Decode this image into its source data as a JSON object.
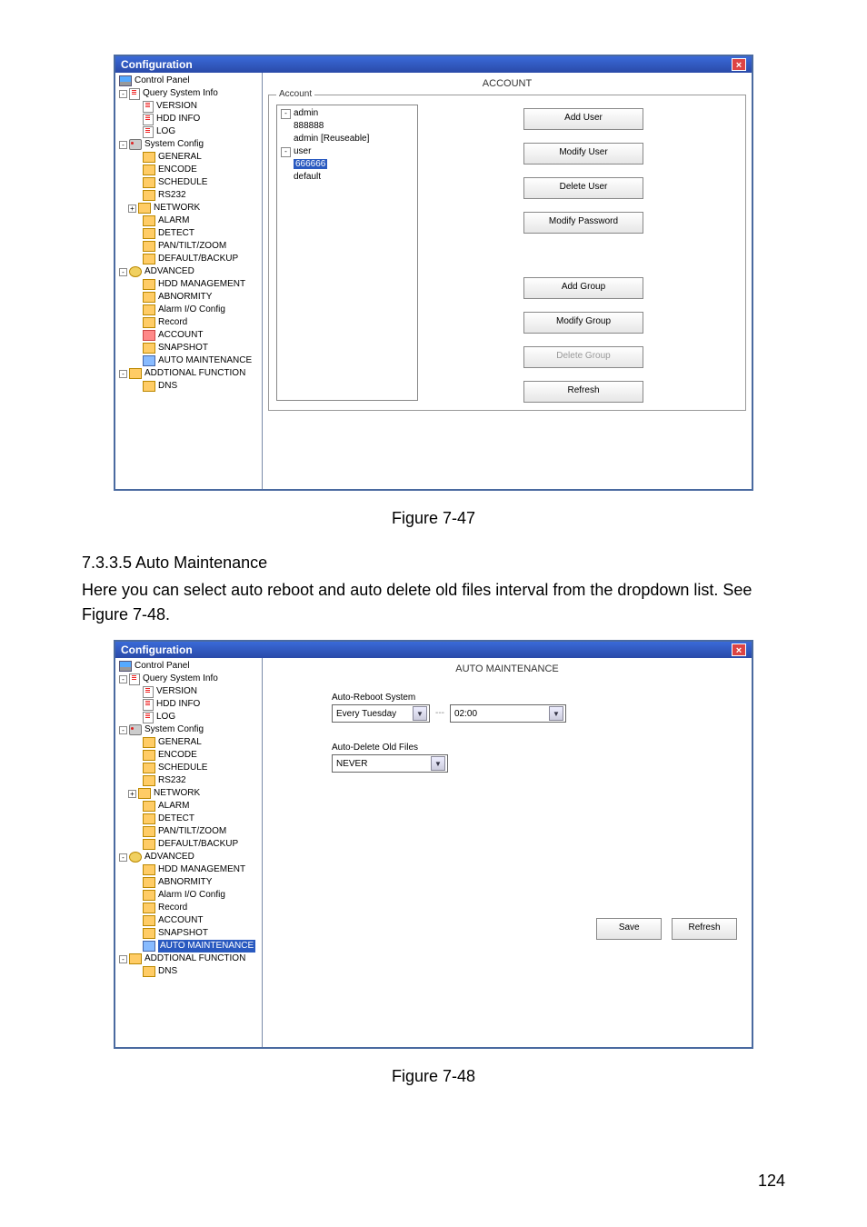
{
  "page_number": "124",
  "figure1_caption": "Figure 7-47",
  "figure2_caption": "Figure 7-48",
  "section_heading": "7.3.3.5  Auto Maintenance",
  "section_body": "Here you can select auto reboot and auto delete old files interval from the dropdown list.  See Figure 7-48.",
  "win": {
    "title": "Configuration",
    "close": "×"
  },
  "tree": {
    "control_panel": "Control Panel",
    "query_system_info": "Query System Info",
    "version": "VERSION",
    "hdd_info": "HDD INFO",
    "log": "LOG",
    "system_config": "System Config",
    "general": "GENERAL",
    "encode": "ENCODE",
    "schedule": "SCHEDULE",
    "rs232": "RS232",
    "network": "NETWORK",
    "alarm": "ALARM",
    "detect": "DETECT",
    "pan_tilt_zoom": "PAN/TILT/ZOOM",
    "default_backup": "DEFAULT/BACKUP",
    "advanced": "ADVANCED",
    "hdd_management": "HDD MANAGEMENT",
    "abnormity": "ABNORMITY",
    "alarm_io_config": "Alarm I/O Config",
    "record": "Record",
    "account": "ACCOUNT",
    "snapshot": "SNAPSHOT",
    "auto_maintenance": "AUTO MAINTENANCE",
    "additional_function": "ADDTIONAL FUNCTION",
    "dns": "DNS"
  },
  "account_panel": {
    "header": "ACCOUNT",
    "legend": "Account",
    "tree": {
      "admin": "admin",
      "n888888": "888888",
      "admin_reuse": "admin [Reuseable]",
      "user": "user",
      "n666666": "666666",
      "default": "default"
    },
    "buttons": {
      "add_user": "Add User",
      "modify_user": "Modify User",
      "delete_user": "Delete User",
      "modify_password": "Modify Password",
      "add_group": "Add Group",
      "modify_group": "Modify Group",
      "delete_group": "Delete Group",
      "refresh": "Refresh"
    }
  },
  "maint_panel": {
    "header": "AUTO MAINTENANCE",
    "auto_reboot_label": "Auto-Reboot System",
    "reboot_day": "Every Tuesday",
    "reboot_time": "02:00",
    "auto_delete_label": "Auto-Delete Old Files",
    "delete_value": "NEVER",
    "save": "Save",
    "refresh": "Refresh"
  }
}
